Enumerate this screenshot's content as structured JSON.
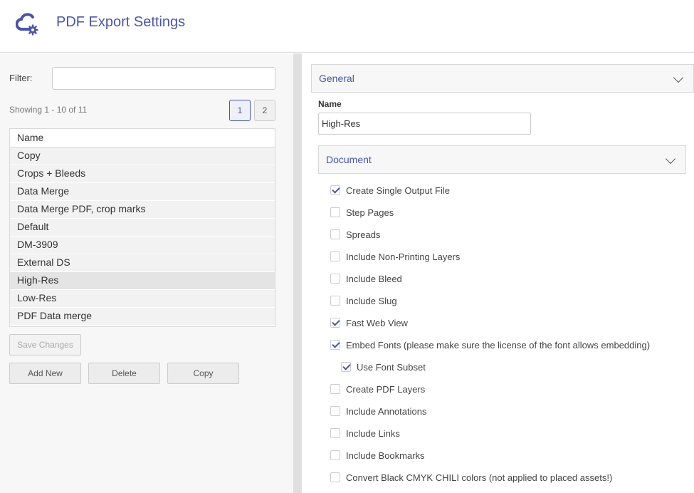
{
  "app": {
    "title": "PDF Export Settings",
    "logo_icon": "cloud-gear-icon",
    "accent": "#4a55a7"
  },
  "left": {
    "filter_label": "Filter:",
    "filter_value": "",
    "showing": "Showing 1 - 10 of 11",
    "pages": [
      "1",
      "2"
    ],
    "current_page": "1",
    "column_header": "Name",
    "rows": [
      "Copy",
      "Crops + Bleeds",
      "Data Merge",
      "Data Merge PDF, crop marks",
      "Default",
      "DM-3909",
      "External DS",
      "High-Res",
      "Low-Res",
      "PDF Data merge"
    ],
    "selected_row": "High-Res",
    "buttons": {
      "save": "Save Changes",
      "add": "Add New",
      "delete": "Delete",
      "copy": "Copy"
    }
  },
  "right": {
    "general_title": "General",
    "name_label": "Name",
    "name_value": "High-Res",
    "document_title": "Document",
    "options": [
      {
        "label": "Create Single Output File",
        "checked": true
      },
      {
        "label": "Step Pages",
        "checked": false
      },
      {
        "label": "Spreads",
        "checked": false
      },
      {
        "label": "Include Non-Printing Layers",
        "checked": false
      },
      {
        "label": "Include Bleed",
        "checked": false
      },
      {
        "label": "Include Slug",
        "checked": false
      },
      {
        "label": "Fast Web View",
        "checked": true
      },
      {
        "label": "Embed Fonts (please make sure the license of the font allows embedding)",
        "checked": true
      },
      {
        "label": "Use Font Subset",
        "checked": true
      },
      {
        "label": "Create PDF Layers",
        "checked": false
      },
      {
        "label": "Include Annotations",
        "checked": false
      },
      {
        "label": "Include Links",
        "checked": false
      },
      {
        "label": "Include Bookmarks",
        "checked": false
      },
      {
        "label": "Convert Black CMYK CHILI colors (not applied to placed assets!)",
        "checked": false
      }
    ]
  }
}
